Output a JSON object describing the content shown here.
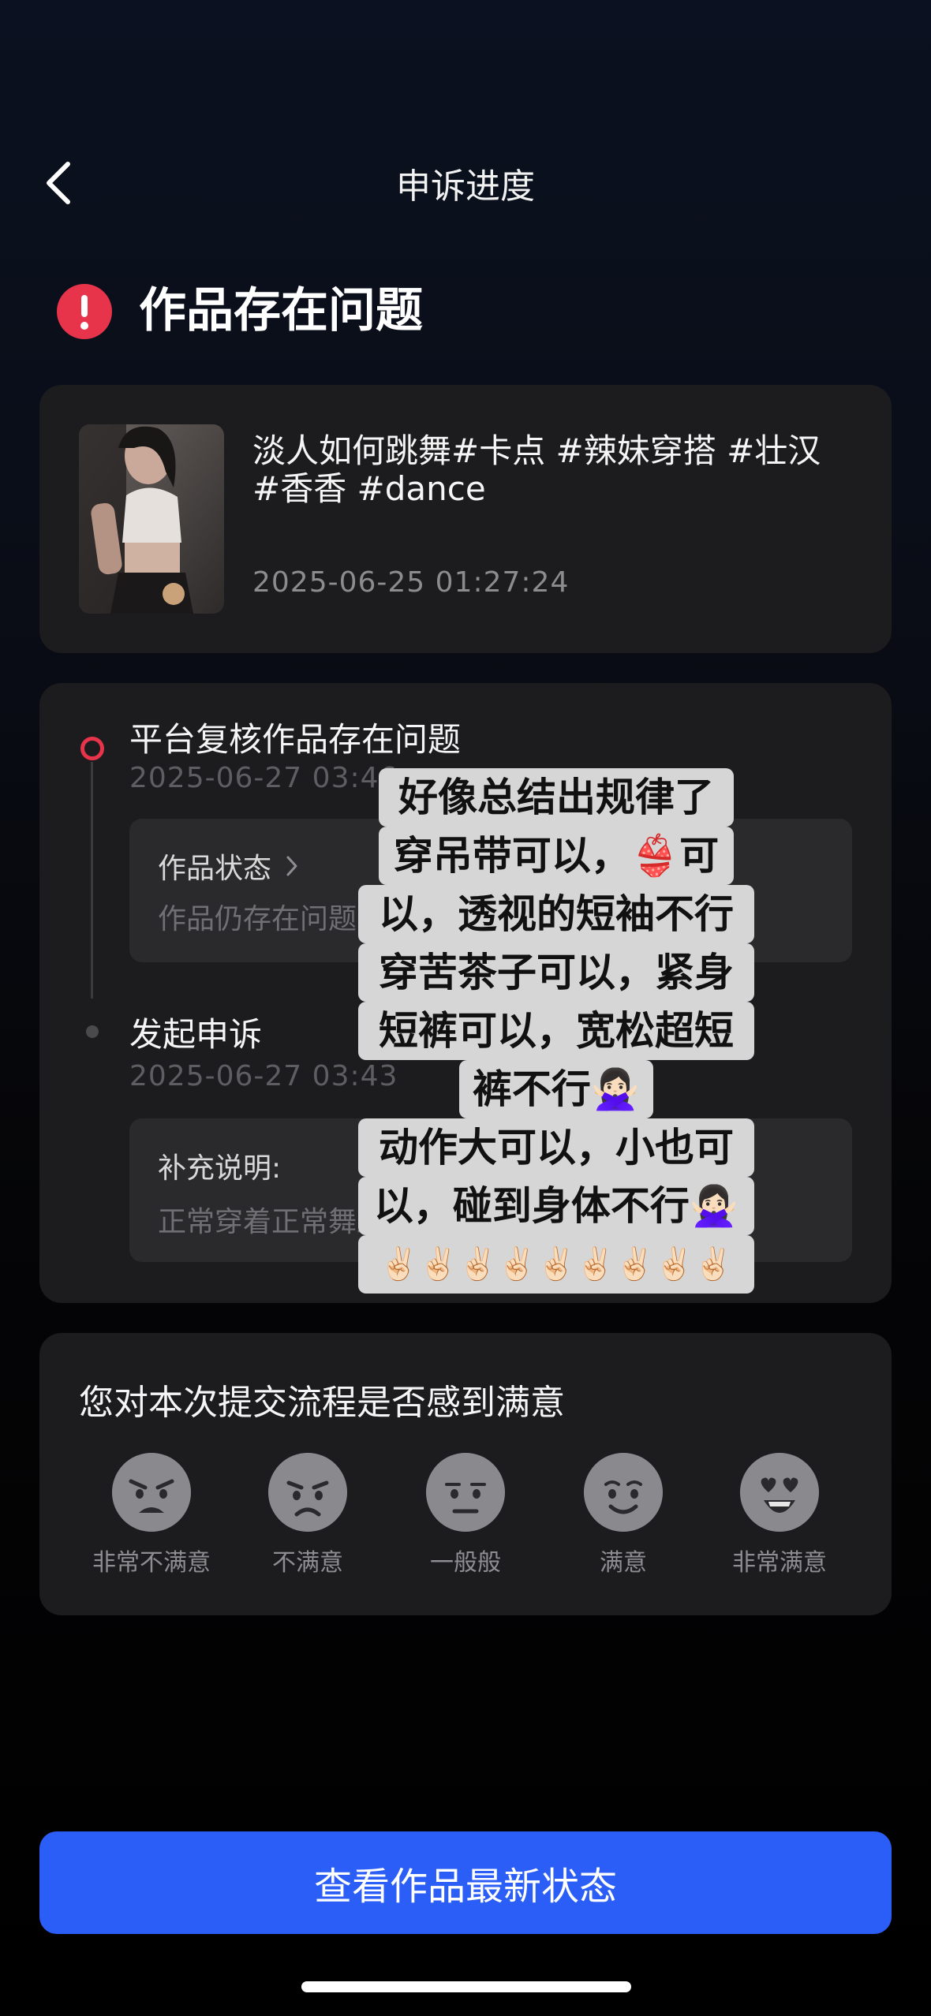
{
  "nav": {
    "title": "申诉进度"
  },
  "status": {
    "title": "作品存在问题"
  },
  "video": {
    "title": "淡人如何跳舞#卡点 #辣妹穿搭 #壮汉 #香香 #dance",
    "time": "2025-06-25 01:27:24"
  },
  "timeline": [
    {
      "title": "平台复核作品存在问题",
      "time": "2025-06-27 03:46",
      "box_label": "作品状态",
      "box_text": "作品仍存在问题，处罚维持"
    },
    {
      "title": "发起申诉",
      "time": "2025-06-27 03:43",
      "box_label": "补充说明:",
      "box_text": "正常穿着正常舞蹈"
    }
  ],
  "survey": {
    "question": "您对本次提交流程是否感到满意",
    "options": [
      "非常不满意",
      "不满意",
      "一般般",
      "满意",
      "非常满意"
    ]
  },
  "caption": {
    "lines": [
      "好像总结出规律了",
      "穿吊带可以，👙可",
      "以，透视的短袖不行",
      "穿苦茶子可以，紧身",
      "短裤可以，宽松超短",
      "裤不行🙅🏻‍♀️",
      "动作大可以，小也可",
      "以，碰到身体不行🙅🏻‍♀️",
      "✌🏻✌🏻✌🏻✌🏻✌🏻✌🏻✌🏻✌🏻✌🏻"
    ]
  },
  "button": {
    "label": "查看作品最新状态"
  },
  "colors": {
    "accent_blue": "#2b5ef7",
    "alert_red": "#e8344a",
    "card_bg": "#1c1c1e"
  }
}
